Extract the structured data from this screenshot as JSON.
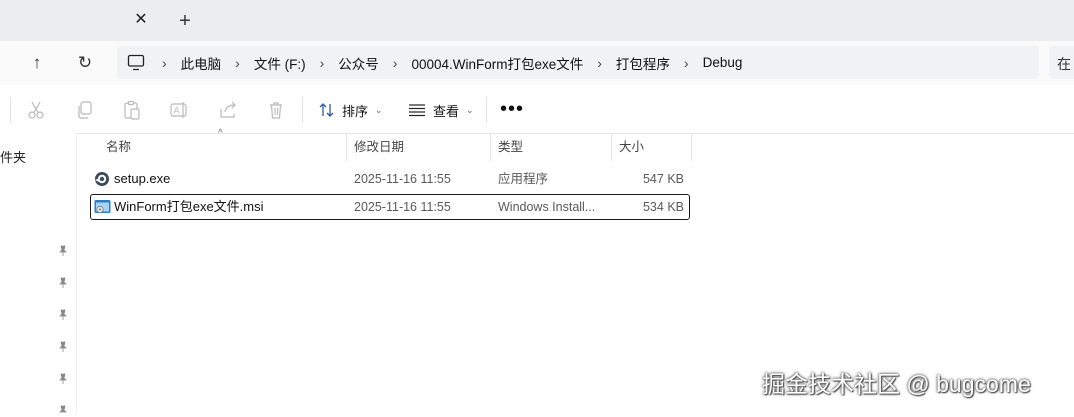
{
  "tab": {
    "close_glyph": "✕",
    "new_glyph": "+"
  },
  "nav": {
    "up_glyph": "↑",
    "refresh_glyph": "↻"
  },
  "breadcrumbs": [
    "此电脑",
    "文件 (F:)",
    "公众号",
    "00004.WinForm打包exe文件",
    "打包程序",
    "Debug"
  ],
  "search_fragment": "在",
  "commands": {
    "sort_label": "排序",
    "view_label": "查看",
    "more_glyph": "•••"
  },
  "nav_pane": {
    "folder_label_fragment": "件夹"
  },
  "columns": {
    "name": "名称",
    "date": "修改日期",
    "type": "类型",
    "size": "大小"
  },
  "files": [
    {
      "name": "setup.exe",
      "date": "2025-11-16 11:55",
      "type": "应用程序",
      "size": "547 KB",
      "icon": "setup-exe-icon",
      "selected": false
    },
    {
      "name": "WinForm打包exe文件.msi",
      "date": "2025-11-16 11:55",
      "type": "Windows Install...",
      "size": "534 KB",
      "icon": "msi-installer-icon",
      "selected": true
    }
  ],
  "watermark": "掘金技术社区 @ bugcome",
  "colors": {
    "tabstrip": "#ecedef",
    "addressbar": "#f1f2f4",
    "selection_border": "#1a1a1a"
  }
}
